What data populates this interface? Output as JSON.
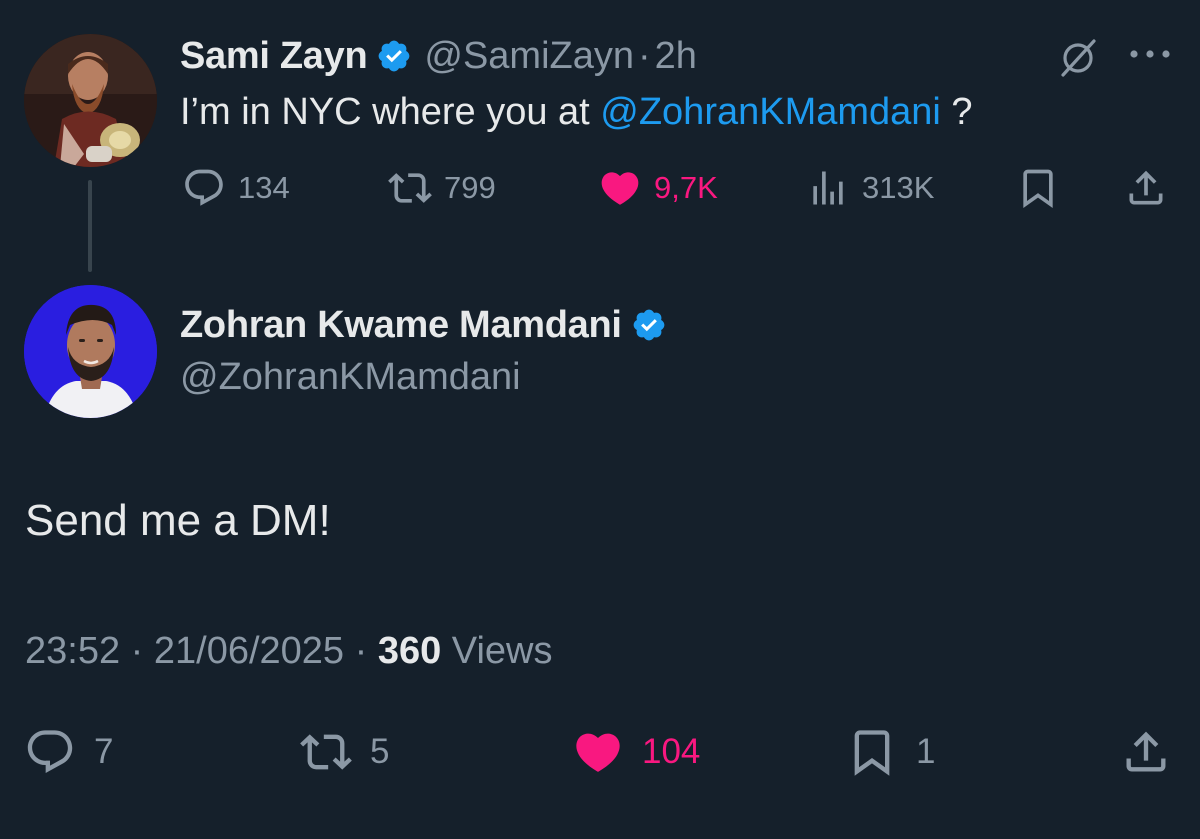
{
  "parent_tweet": {
    "author_name": "Sami Zayn",
    "handle": "@SamiZayn",
    "separator": "·",
    "time": "2h",
    "text_before": "I’m in NYC where you at ",
    "mention": "@ZohranKMamdani",
    "text_after": " ?",
    "replies": "134",
    "reposts": "799",
    "likes": "9,7K",
    "views": "313K",
    "icons": [
      "verified-badge-icon",
      "grok-icon",
      "more-icon",
      "reply-icon",
      "repost-icon",
      "like-icon",
      "views-icon",
      "bookmark-icon",
      "share-icon"
    ]
  },
  "main_tweet": {
    "author_name": "Zohran Kwame Mamdani",
    "handle": "@ZohranKMamdani",
    "text": "Send me a DM!",
    "timestamp": "23:52 · 21/06/2025 · ",
    "views_count": "360",
    "views_label": " Views",
    "replies": "7",
    "reposts": "5",
    "likes": "104",
    "bookmarks": "1"
  },
  "colors": {
    "background": "#15202b",
    "text": "#e7e9ea",
    "secondary": "#8b98a5",
    "accent_blue": "#1d9bf0",
    "like_pink": "#f91880"
  }
}
